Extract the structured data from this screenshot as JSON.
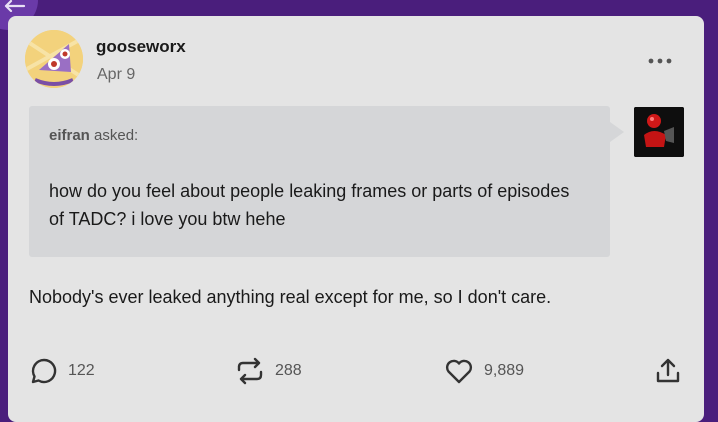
{
  "post": {
    "username": "gooseworx",
    "date": "Apr 9",
    "ask": {
      "asker": "eifran",
      "asked_label": "asked:",
      "question": "how do you feel about people leaking frames or parts of episodes of TADC? i love you btw hehe"
    },
    "answer": "Nobody's ever leaked anything real except for me, so I don't care.",
    "stats": {
      "replies": "122",
      "reblogs": "288",
      "likes": "9,889"
    }
  },
  "icons": {
    "back": "arrow-left-icon",
    "more": "more-horizontal-icon",
    "reply": "reply-bubble-icon",
    "reblog": "reblog-icon",
    "like": "heart-icon",
    "share": "share-icon"
  },
  "colors": {
    "background": "#4a1e7c",
    "card": "#e4e4e4",
    "ask_box": "#d5d6d8",
    "text": "#1a1a1a",
    "muted": "#555555"
  }
}
